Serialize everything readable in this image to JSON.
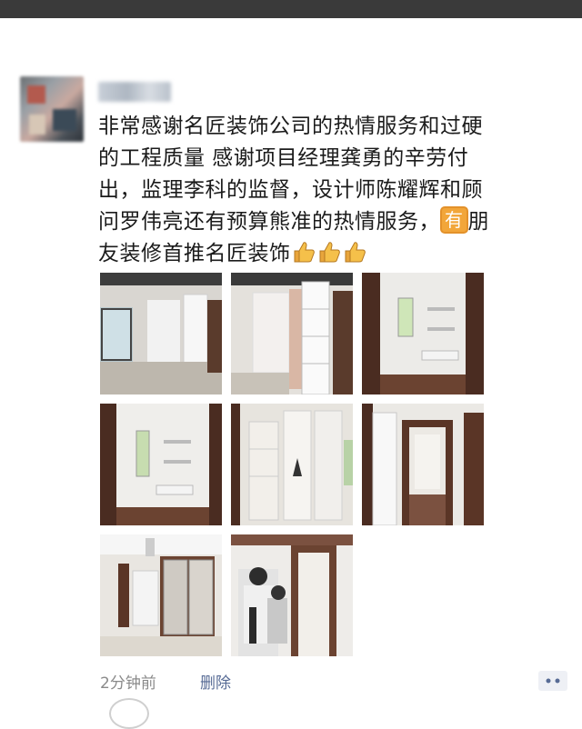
{
  "post": {
    "lines": [
      "非常感谢名匠装饰公司的热情服务和过硬",
      "的工程质量 感谢项目经理龚勇的辛劳付",
      "出，监理李科的监督，设计师陈耀辉和顾",
      "问罗伟亮还有预算熊准的热情服务，",
      "友装修首推名匠装饰"
    ],
    "line4_emoji": "有",
    "line4_after": "朋",
    "thumbs_icon": "thumbs-up-emoji"
  },
  "photos": [
    "photo-1",
    "photo-2",
    "photo-3",
    "photo-4",
    "photo-5",
    "photo-6",
    "photo-7",
    "photo-8"
  ],
  "footer": {
    "time": "2分钟前",
    "delete": "删除"
  },
  "colors": {
    "link": "#576b95",
    "meta": "#8a8a8a",
    "emoji_bg": "#f2a63a"
  }
}
